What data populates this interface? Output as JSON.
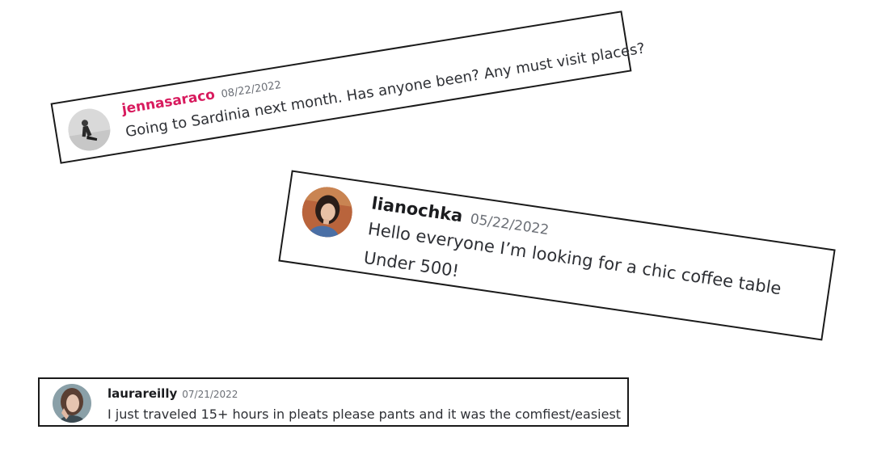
{
  "comments": [
    {
      "username": "jennasaraco",
      "date": "08/22/2022",
      "message": "Going to Sardinia next month. Has anyone been? Any must visit places?",
      "username_color": "#d81b5e",
      "avatar_icon": "person-avatar-icon"
    },
    {
      "username": "lianochka",
      "date": "05/22/2022",
      "message_line1": "Hello everyone I’m looking for a chic coffee table",
      "message_line2": "Under 500!",
      "avatar_icon": "person-avatar-icon"
    },
    {
      "username": "laurareilly",
      "date": "07/21/2022",
      "message": "I just traveled 15+ hours in pleats please pants and it was the comfiest/easiest",
      "avatar_icon": "person-avatar-icon"
    }
  ]
}
